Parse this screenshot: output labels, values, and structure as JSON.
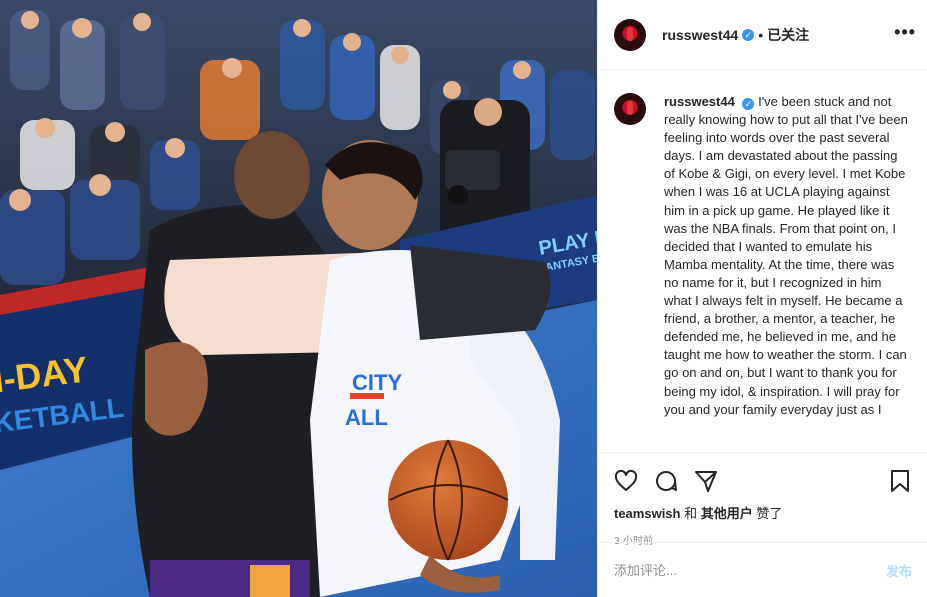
{
  "post": {
    "username": "russwest44",
    "verified_mark": "✓",
    "follow_separator": "•",
    "follow_state": "已关注",
    "more_label": "•••",
    "photo_text": {
      "banner_left_1": "I-DAY",
      "banner_left_2": "KETBALL",
      "banner_right_1": "PLAY FR",
      "banner_right_2": "FANTASY BA",
      "jersey_1": "CITY",
      "jersey_2": "ALL"
    }
  },
  "caption": {
    "username": "russwest44",
    "text": "I've been stuck and not really knowing how to put all that I've been feeling into words over the past several days. I am devastated about the passing of Kobe & Gigi, on every level. I met Kobe when I was 16 at UCLA playing against him in a pick up game. He played like it was the NBA finals. From that point on, I decided that I wanted to emulate his Mamba mentality. At the time, there was no name for it, but I recognized in him what I always felt in myself. He became a friend, a brother, a mentor, a teacher, he defended me, he believed in me, and he taught me how to weather the storm. I can go on and on, but I want to thank you for being my idol, & inspiration. I will pray for you and your family everyday just as I"
  },
  "actions": {
    "like_icon": "heart-icon",
    "comment_icon": "speech-bubble-icon",
    "share_icon": "paper-plane-icon",
    "save_icon": "bookmark-icon"
  },
  "likes": {
    "user": "teamswish",
    "conj": "和",
    "others": "其他用户",
    "suffix": "赞了"
  },
  "timestamp": "3 小时前",
  "comment": {
    "placeholder": "添加评论...",
    "post_label": "发布"
  },
  "colors": {
    "verified": "#3897f0",
    "post_button_disabled": "#b2dffc",
    "meta_gray": "#8e8e8e",
    "border": "#efefef"
  }
}
